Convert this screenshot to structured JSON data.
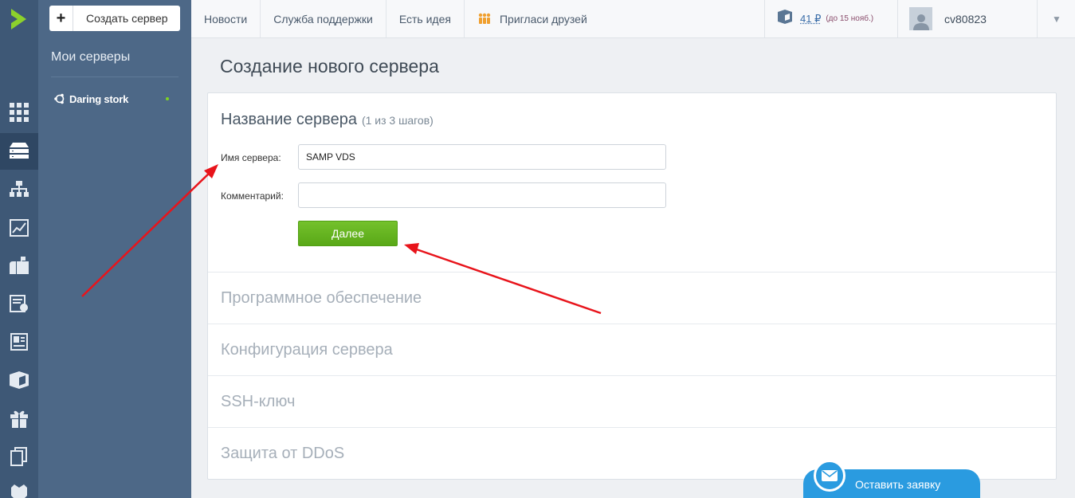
{
  "sidebar": {
    "create_label": "Создать сервер",
    "section_title": "Мои серверы",
    "servers": [
      {
        "name": "Daring stork",
        "status_color": "#7ed321"
      }
    ]
  },
  "rail_icons": [
    "logo-icon",
    "dashboard-icon",
    "servers-icon",
    "network-icon",
    "statistics-icon",
    "mailbox-icon",
    "billing-icon",
    "documents-icon",
    "marketplace-icon",
    "gift-icon",
    "copy-icon",
    "shield-icon"
  ],
  "topnav": {
    "items": [
      "Новости",
      "Служба поддержки",
      "Есть идея",
      "Пригласи друзей"
    ]
  },
  "balance": {
    "amount": "41 ₽",
    "until": "(до 15 нояб.)"
  },
  "user": {
    "name": "cv80823"
  },
  "page": {
    "title": "Создание нового сервера"
  },
  "form": {
    "step_title": "Название сервера",
    "step_count": "(1 из 3 шагов)",
    "name_label": "Имя сервера:",
    "name_value": "SAMP VDS",
    "comment_label": "Комментарий:",
    "comment_value": "",
    "next_label": "Далее"
  },
  "sections": [
    "Программное обеспечение",
    "Конфигурация сервера",
    "SSH-ключ",
    "Защита от DDoS"
  ],
  "chat": {
    "label": "Оставить заявку"
  },
  "colors": {
    "accent_green": "#5fb01d",
    "rail_bg": "#3e5876",
    "sidebar_bg": "#4d6887",
    "chat_blue": "#2a9be0",
    "annotation_red": "#e8141b"
  }
}
